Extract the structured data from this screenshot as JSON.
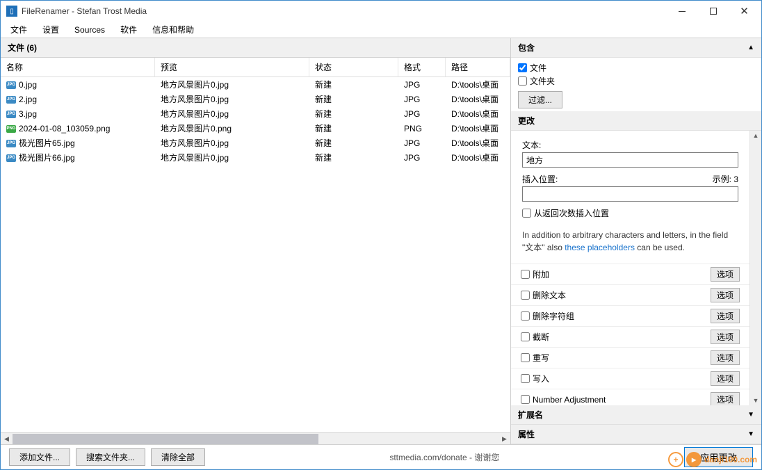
{
  "window": {
    "title": "FileRenamer - Stefan Trost Media"
  },
  "menu": {
    "items": [
      "文件",
      "设置",
      "Sources",
      "软件",
      "信息和帮助"
    ]
  },
  "left": {
    "header": "文件 (6)",
    "columns": {
      "name": "名称",
      "preview": "预览",
      "status": "状态",
      "format": "格式",
      "path": "路径"
    },
    "rows": [
      {
        "name": "0.jpg",
        "preview": "地方风景图片0.jpg",
        "status": "新建",
        "format": "JPG",
        "path": "D:\\tools\\桌面",
        "type": "jpg"
      },
      {
        "name": "2.jpg",
        "preview": "地方风景图片0.jpg",
        "status": "新建",
        "format": "JPG",
        "path": "D:\\tools\\桌面",
        "type": "jpg"
      },
      {
        "name": "3.jpg",
        "preview": "地方风景图片0.jpg",
        "status": "新建",
        "format": "JPG",
        "path": "D:\\tools\\桌面",
        "type": "jpg"
      },
      {
        "name": "2024-01-08_103059.png",
        "preview": "地方风景图片0.png",
        "status": "新建",
        "format": "PNG",
        "path": "D:\\tools\\桌面",
        "type": "png"
      },
      {
        "name": "极光图片65.jpg",
        "preview": "地方风景图片0.jpg",
        "status": "新建",
        "format": "JPG",
        "path": "D:\\tools\\桌面",
        "type": "jpg"
      },
      {
        "name": "极光图片66.jpg",
        "preview": "地方风景图片0.jpg",
        "status": "新建",
        "format": "JPG",
        "path": "D:\\tools\\桌面",
        "type": "jpg"
      }
    ]
  },
  "right": {
    "include": {
      "header": "包含",
      "files": "文件",
      "folders": "文件夹",
      "filter": "过滤..."
    },
    "change": {
      "header": "更改",
      "text_label": "文本:",
      "text_value": "地方",
      "position_label": "插入位置:",
      "example_label": "示例: 3",
      "reverse_label": "从返回次数插入位置",
      "info_pre": "In addition to arbitrary characters and letters, in the field \"文本\" also ",
      "info_link": "these placeholders",
      "info_post": " can be used.",
      "options": [
        {
          "label": "附加",
          "btn": "选项"
        },
        {
          "label": "删除文本",
          "btn": "选项"
        },
        {
          "label": "删除字符组",
          "btn": "选项"
        },
        {
          "label": "截断",
          "btn": "选项"
        },
        {
          "label": "重写",
          "btn": "选项"
        },
        {
          "label": "写入",
          "btn": "选项"
        },
        {
          "label": "Number Adjustment",
          "btn": "选项"
        }
      ]
    },
    "extension": "扩展名",
    "attributes": "属性"
  },
  "footer": {
    "add": "添加文件...",
    "search": "搜索文件夹...",
    "clear": "清除全部",
    "donate": "sttmedia.com/donate - 谢谢您",
    "apply": "应用更改"
  },
  "watermark": "danji100.com"
}
